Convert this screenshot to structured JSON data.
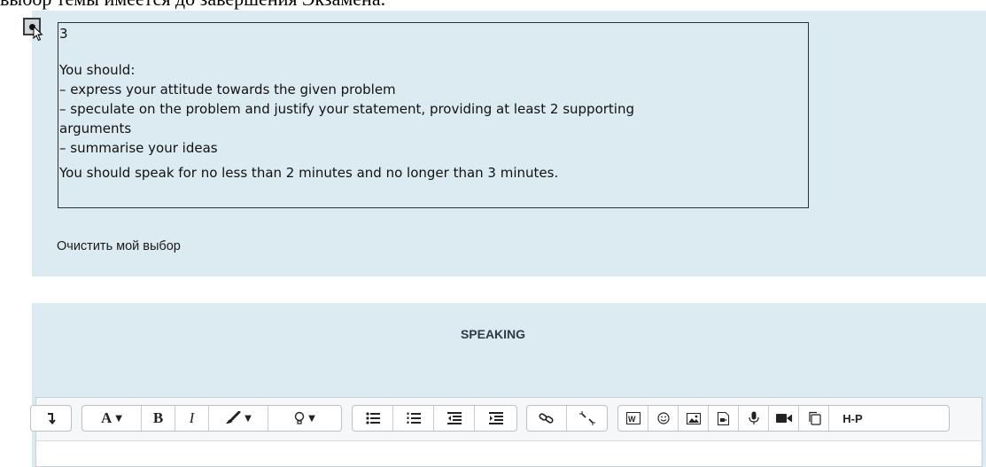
{
  "page": {
    "top_text": "выбор темы имеется до завершения Экзамена."
  },
  "question": {
    "option_number": "3",
    "lines": [
      "You should:",
      "– express your attitude towards the given problem",
      "– speculate on the problem and justify your statement, providing at least 2 supporting",
      "arguments",
      "– summarise your ideas",
      "You should speak for no less than 2 minutes and no longer than 3 minutes."
    ],
    "clear_choice_label": "Очистить мой выбор"
  },
  "speaking": {
    "title": "SPEAKING"
  },
  "toolbar": {
    "bold_label": "B",
    "italic_label": "I",
    "font_label": "A",
    "h5p_label": "H-P"
  }
}
